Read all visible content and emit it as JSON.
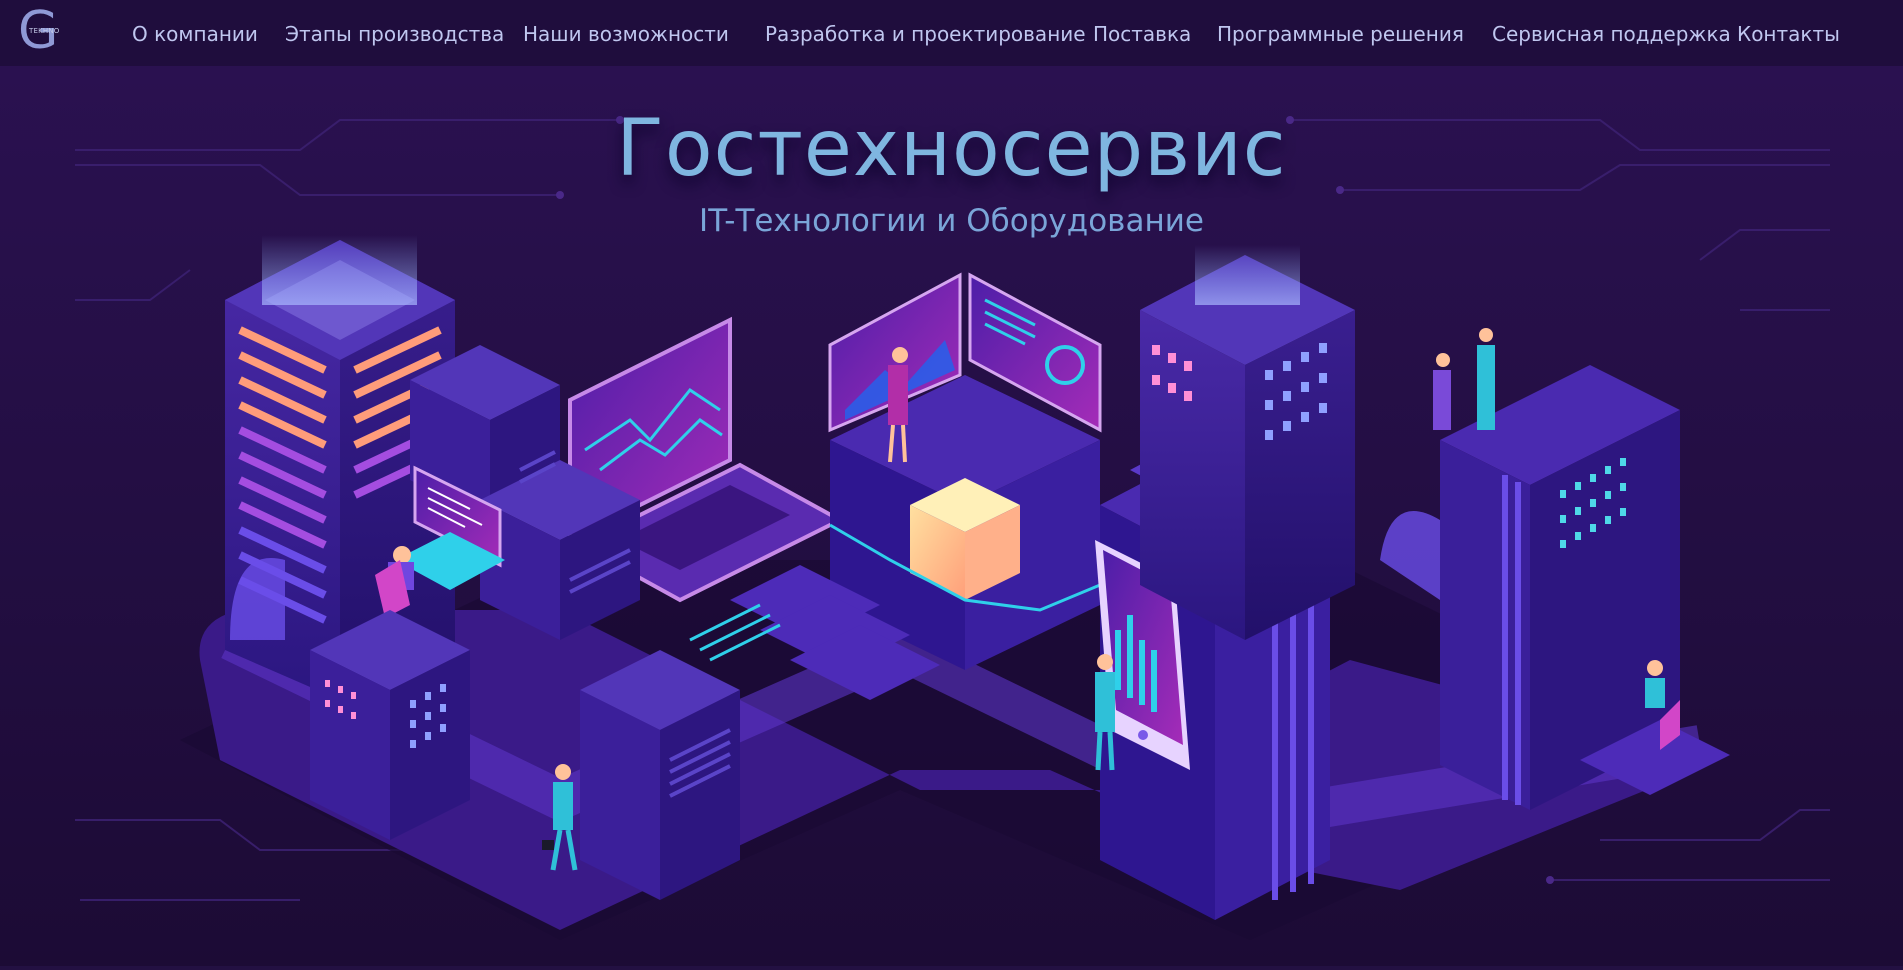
{
  "logo": {
    "letter": "G",
    "tag": "TEKHNO"
  },
  "nav": {
    "items": [
      {
        "label": "О компании"
      },
      {
        "label": "Этапы производства"
      },
      {
        "label": "Наши возможности"
      },
      {
        "label": "Разработка и проектирование"
      },
      {
        "label": "Поставка"
      },
      {
        "label": "Программные решения"
      },
      {
        "label": "Сервисная поддержка"
      },
      {
        "label": "Контакты"
      }
    ]
  },
  "hero": {
    "title": "Гостехносервис",
    "subtitle": "IT-Технологии и Оборудование"
  },
  "colors": {
    "background": "#231042",
    "nav_background": "#1f0d3d",
    "nav_text": "#bfc6ef",
    "title": "#7fb6e0",
    "accent_cyan": "#2fd0ea",
    "accent_purple": "#6a2bd0"
  }
}
